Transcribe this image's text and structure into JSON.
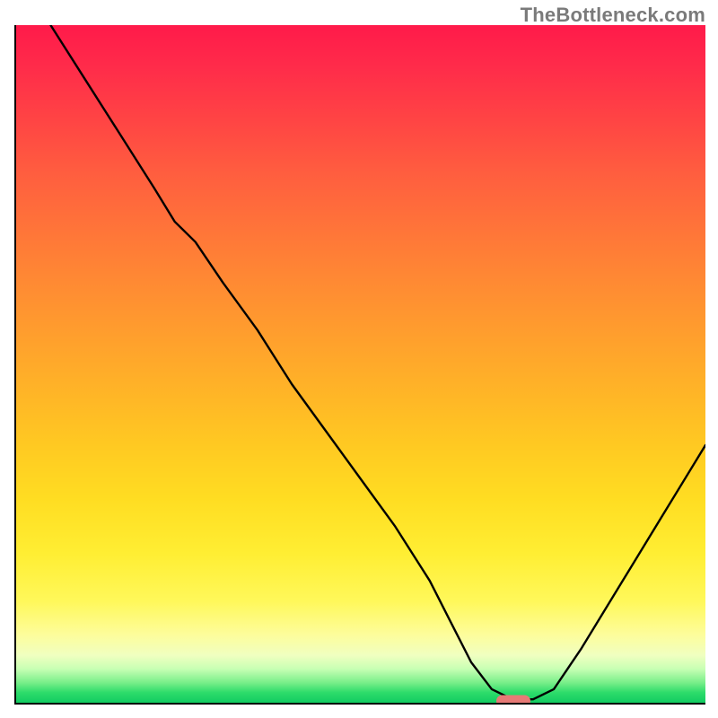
{
  "watermark": "TheBottleneck.com",
  "chart_data": {
    "type": "line",
    "title": "",
    "xlabel": "",
    "ylabel": "",
    "xlim": [
      0,
      100
    ],
    "ylim": [
      0,
      100
    ],
    "grid": false,
    "legend": false,
    "background": "gradient red→yellow→green (top→bottom)",
    "annotations": [
      {
        "type": "marker",
        "x": 72,
        "y": 0.5,
        "color": "#e77a76",
        "shape": "rounded-bar"
      }
    ],
    "series": [
      {
        "name": "bottleneck-curve",
        "color": "#000000",
        "x": [
          5,
          10,
          15,
          20,
          23,
          26,
          30,
          35,
          40,
          45,
          50,
          55,
          60,
          63,
          66,
          69,
          72,
          75,
          78,
          82,
          88,
          94,
          100
        ],
        "y": [
          100,
          92,
          84,
          76,
          71,
          68,
          62,
          55,
          47,
          40,
          33,
          26,
          18,
          12,
          6,
          2,
          0.5,
          0.5,
          2,
          8,
          18,
          28,
          38
        ]
      }
    ]
  },
  "colors": {
    "axis": "#000000",
    "watermark": "#7a7a7a",
    "marker": "#e77a76"
  }
}
